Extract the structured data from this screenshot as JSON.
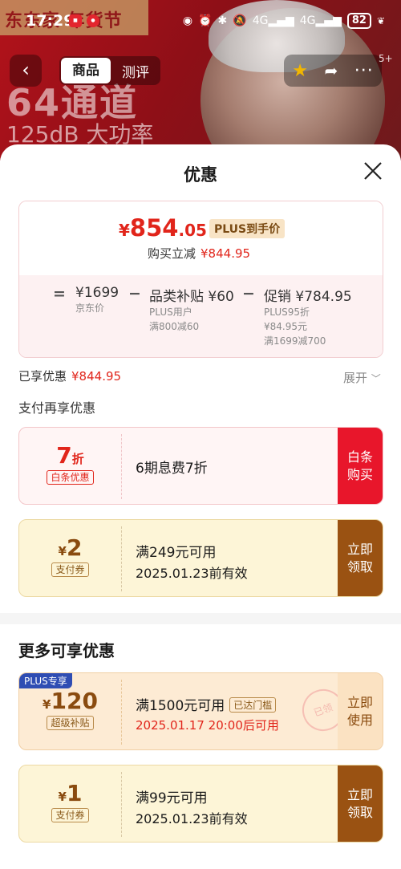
{
  "status_bar": {
    "time": "17:29",
    "network1": "4G",
    "network2": "4G",
    "battery": "82"
  },
  "background": {
    "banner": "东东家 年货节",
    "headline": "64通道",
    "subline": "125dB 大功率"
  },
  "nav": {
    "tabs": [
      "商品",
      "测评"
    ],
    "active_tab": "商品",
    "count_badge": "5+"
  },
  "sheet": {
    "title": "优惠",
    "price": {
      "symbol": "¥",
      "integer": "854",
      "decimal": ".05",
      "plus_tag": "PLUS到手价",
      "buy_reduce_label": "购买立减",
      "buy_reduce_amount": "¥844.95"
    },
    "calc": {
      "eq": "=",
      "jd_price": "¥1699",
      "jd_price_label": "京东价",
      "op1": "−",
      "subsidy_title": "品类补贴 ¥60",
      "subsidy_sub1": "PLUS用户",
      "subsidy_sub2": "满800减60",
      "op2": "−",
      "promo_title": "促销 ¥784.95",
      "promo_sub1": "PLUS95折",
      "promo_sub2": "¥84.95元",
      "promo_sub3": "满1699减700"
    },
    "enjoyed_label": "已享优惠",
    "enjoyed_amount": "¥844.95",
    "expand_label": "展开",
    "pay_more_label": "支付再享优惠",
    "coupons": [
      {
        "amount": "7",
        "unit": "折",
        "tag": "白条优惠",
        "desc": "6期息费7折",
        "button": "白条\n购买"
      },
      {
        "symbol": "¥",
        "amount": "2",
        "tag": "支付券",
        "line1": "满249元可用",
        "line2": "2025.01.23前有效",
        "button": "立即\n领取"
      }
    ],
    "more_title": "更多可享优惠",
    "more_coupons": [
      {
        "badge": "PLUS专享",
        "symbol": "¥",
        "amount": "120",
        "tag": "超级补贴",
        "line1": "满1500元可用",
        "threshold": "已达门槛",
        "line2": "2025.01.17 20:00后可用",
        "button": "立即\n使用",
        "stamp": "已领"
      },
      {
        "symbol": "¥",
        "amount": "1",
        "tag": "支付券",
        "line1": "满99元可用",
        "line2": "2025.01.23前有效",
        "button": "立即\n领取"
      }
    ]
  },
  "colors": {
    "accent_red": "#e1251b",
    "gold_brown": "#9a5212",
    "plus_blue": "#2f4db3"
  }
}
